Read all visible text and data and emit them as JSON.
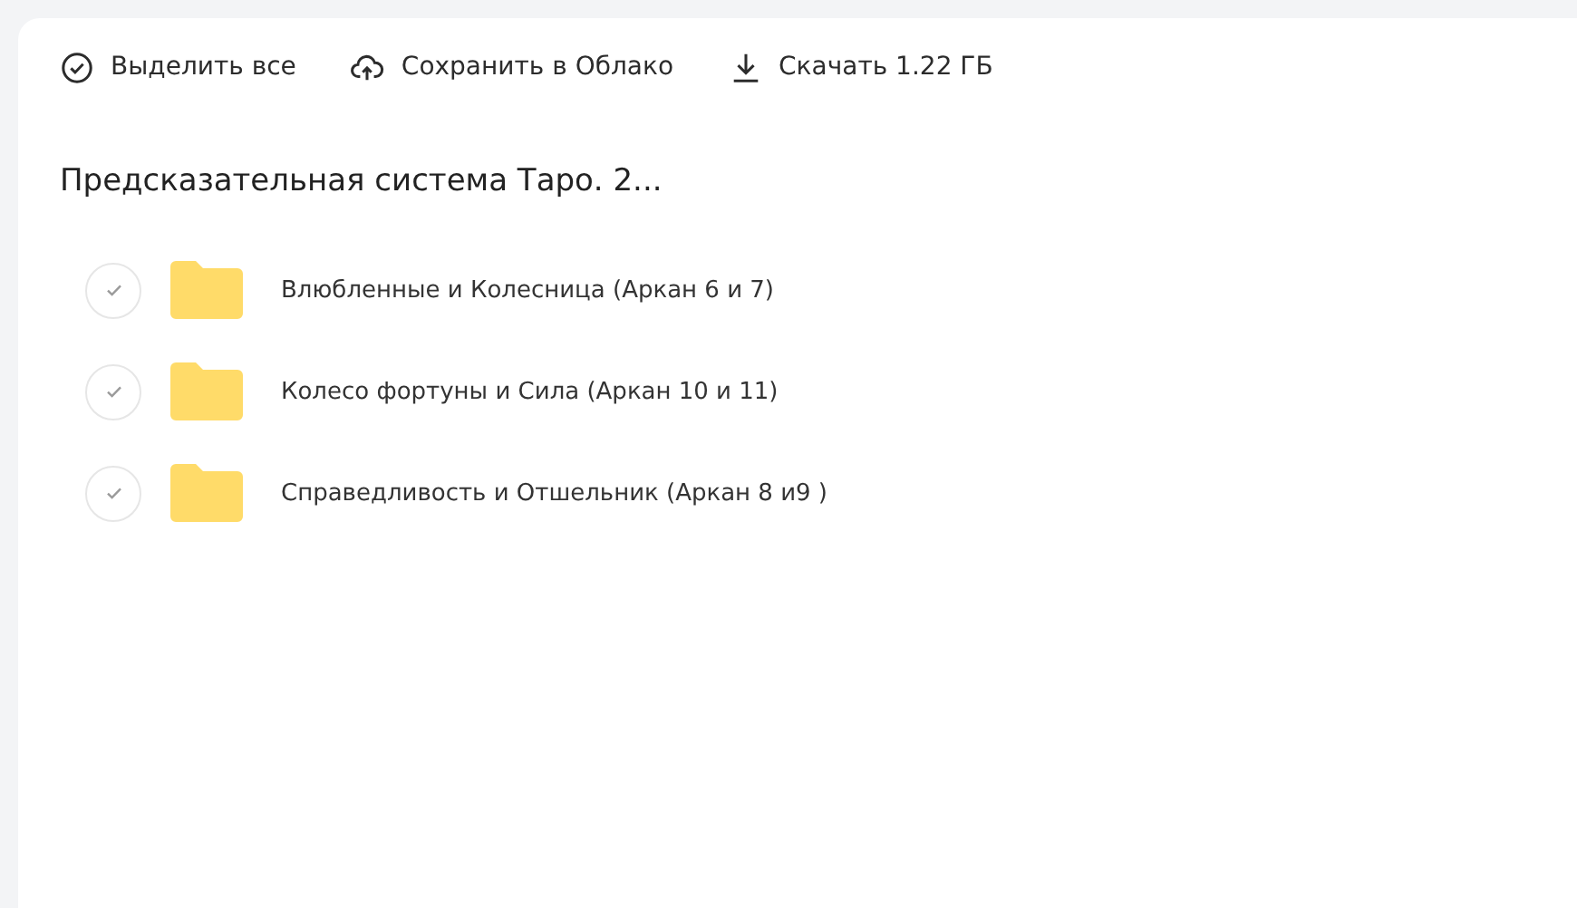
{
  "toolbar": [
    {
      "kind": "select",
      "label": "Выделить все"
    },
    {
      "kind": "cloud",
      "label": "Сохранить в Облако"
    },
    {
      "kind": "download",
      "label": "Скачать 1.22 ГБ"
    }
  ],
  "title": "Предсказательная система Таро. 2...",
  "items": [
    {
      "name": "Влюбленные и Колесница (Аркан 6 и 7)",
      "checked": false
    },
    {
      "name": "Колесо фортуны и Сила (Аркан 10 и 11)",
      "checked": false
    },
    {
      "name": "Справедливость и Отшельник (Аркан 8 и9 )",
      "checked": false
    }
  ]
}
